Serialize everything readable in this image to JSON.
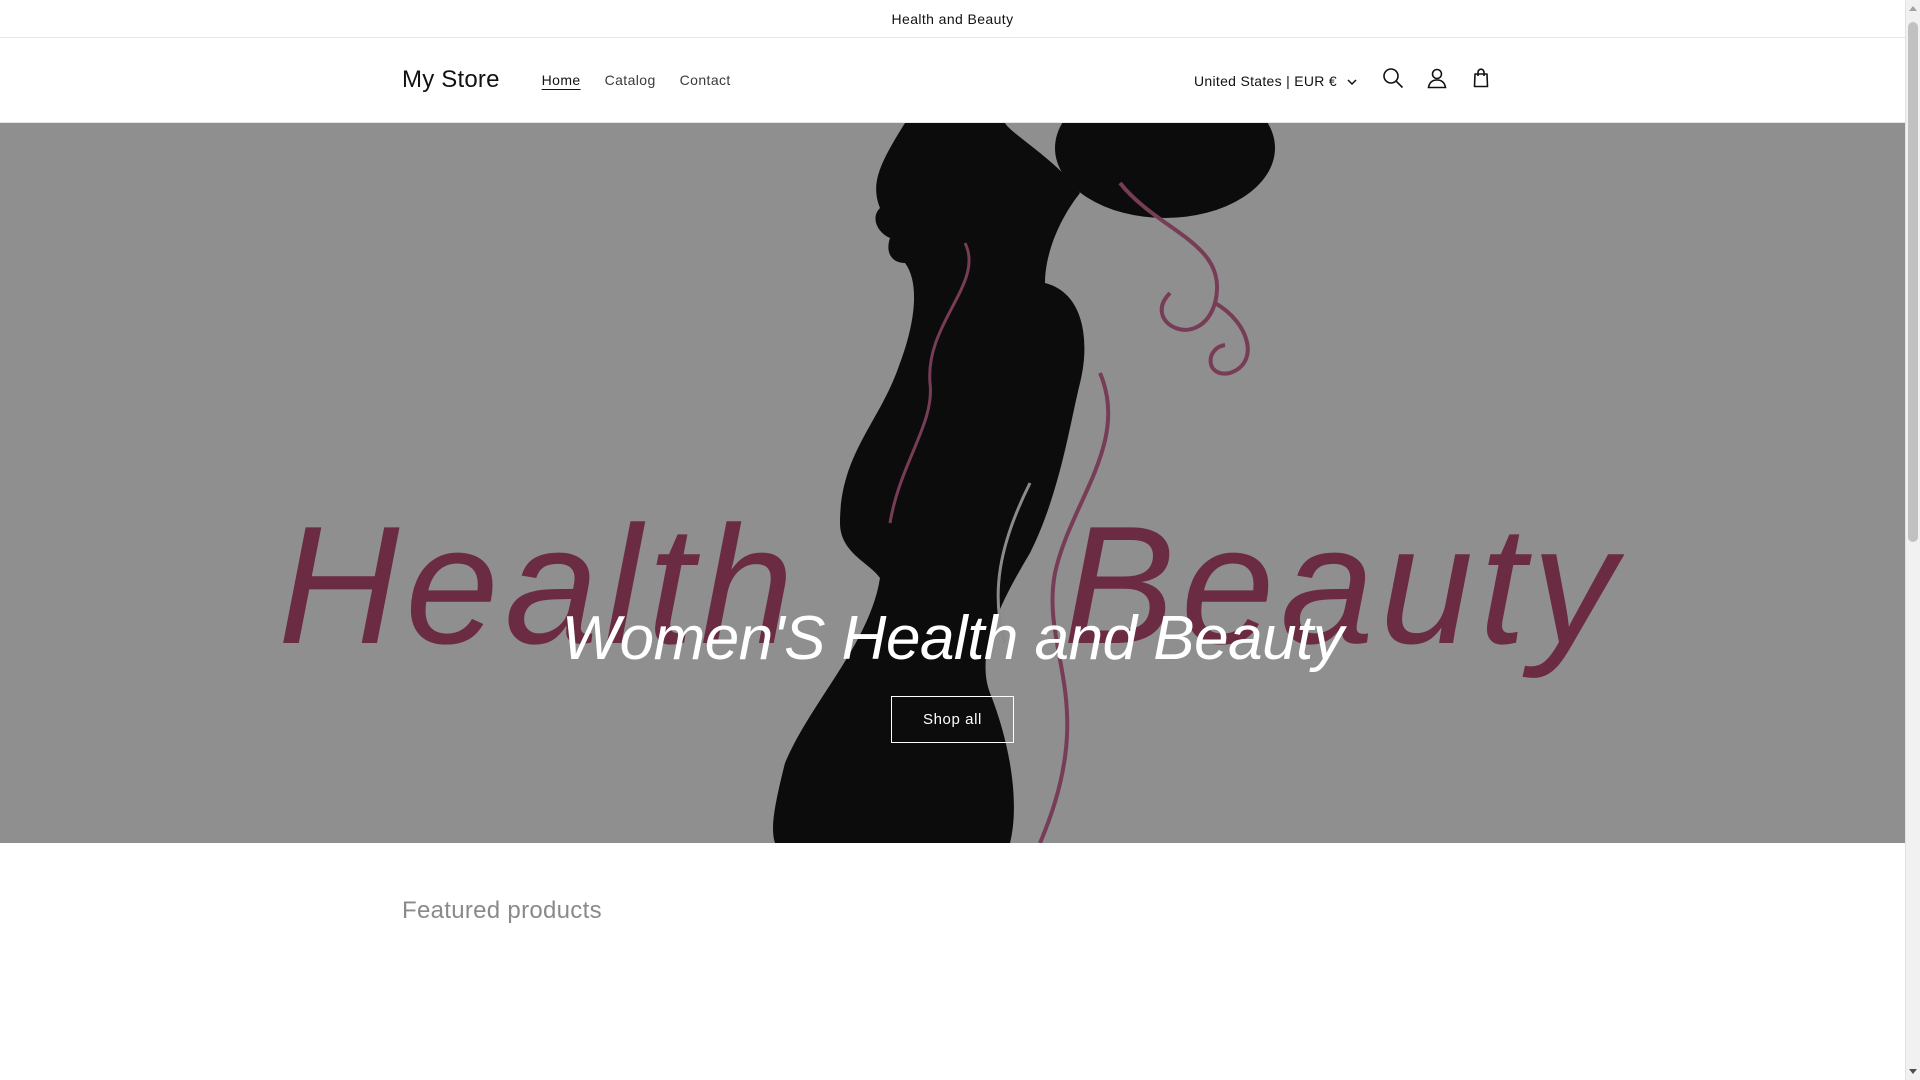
{
  "announcement": {
    "text": "Health and Beauty"
  },
  "header": {
    "logo": "My Store",
    "nav": [
      {
        "label": "Home",
        "active": true
      },
      {
        "label": "Catalog",
        "active": false
      },
      {
        "label": "Contact",
        "active": false
      }
    ],
    "localization": "United States | EUR €",
    "icons": [
      "search-icon",
      "account-icon",
      "cart-icon"
    ]
  },
  "hero": {
    "title": "Women'S Health and Beauty",
    "button_label": "Shop all",
    "image_text": "Health Beauty"
  },
  "featured": {
    "title": "Featured products"
  },
  "colors": {
    "text": "#121212",
    "muted": "#8a8a8a",
    "accent_pink": "#b3486f",
    "silhouette": "#141414"
  }
}
